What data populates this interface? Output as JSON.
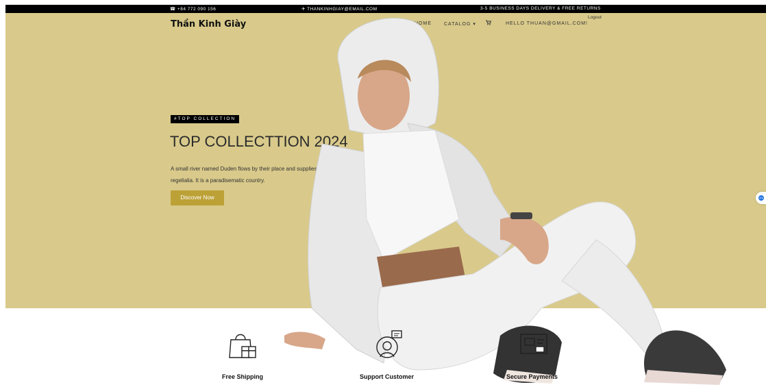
{
  "topbar": {
    "phone": "☎ +84 772 090 156",
    "email": "✈ THANKINHGIAY@EMAIL.COM",
    "delivery": "3-5 BUSINESS DAYS DELIVERY & FREE RETURNS"
  },
  "header": {
    "brand": "Thần Kinh Giày",
    "nav": {
      "home": "HOME",
      "catalog": "CATALOG ▾",
      "cart_icon": "cart-icon",
      "user": "HELLO THUAN@GMAIL.COM!",
      "logout": "Logout"
    }
  },
  "hero": {
    "badge": "#TOP COLLECTION",
    "title": "TOP COLLECTTION 2024",
    "description": "A small river named Duden flows by their place and supplies it with the necessary regelialia. It is a paradisematic country.",
    "cta": "Discover Now",
    "background_color": "#d9ca8b",
    "accent_color": "#bca136"
  },
  "features": [
    {
      "icon": "shopping-bag-gift-icon",
      "label": "Free Shipping"
    },
    {
      "icon": "support-headset-icon",
      "label": "Support Customer"
    },
    {
      "icon": "secure-payment-icon",
      "label": "Secure Payments"
    }
  ]
}
